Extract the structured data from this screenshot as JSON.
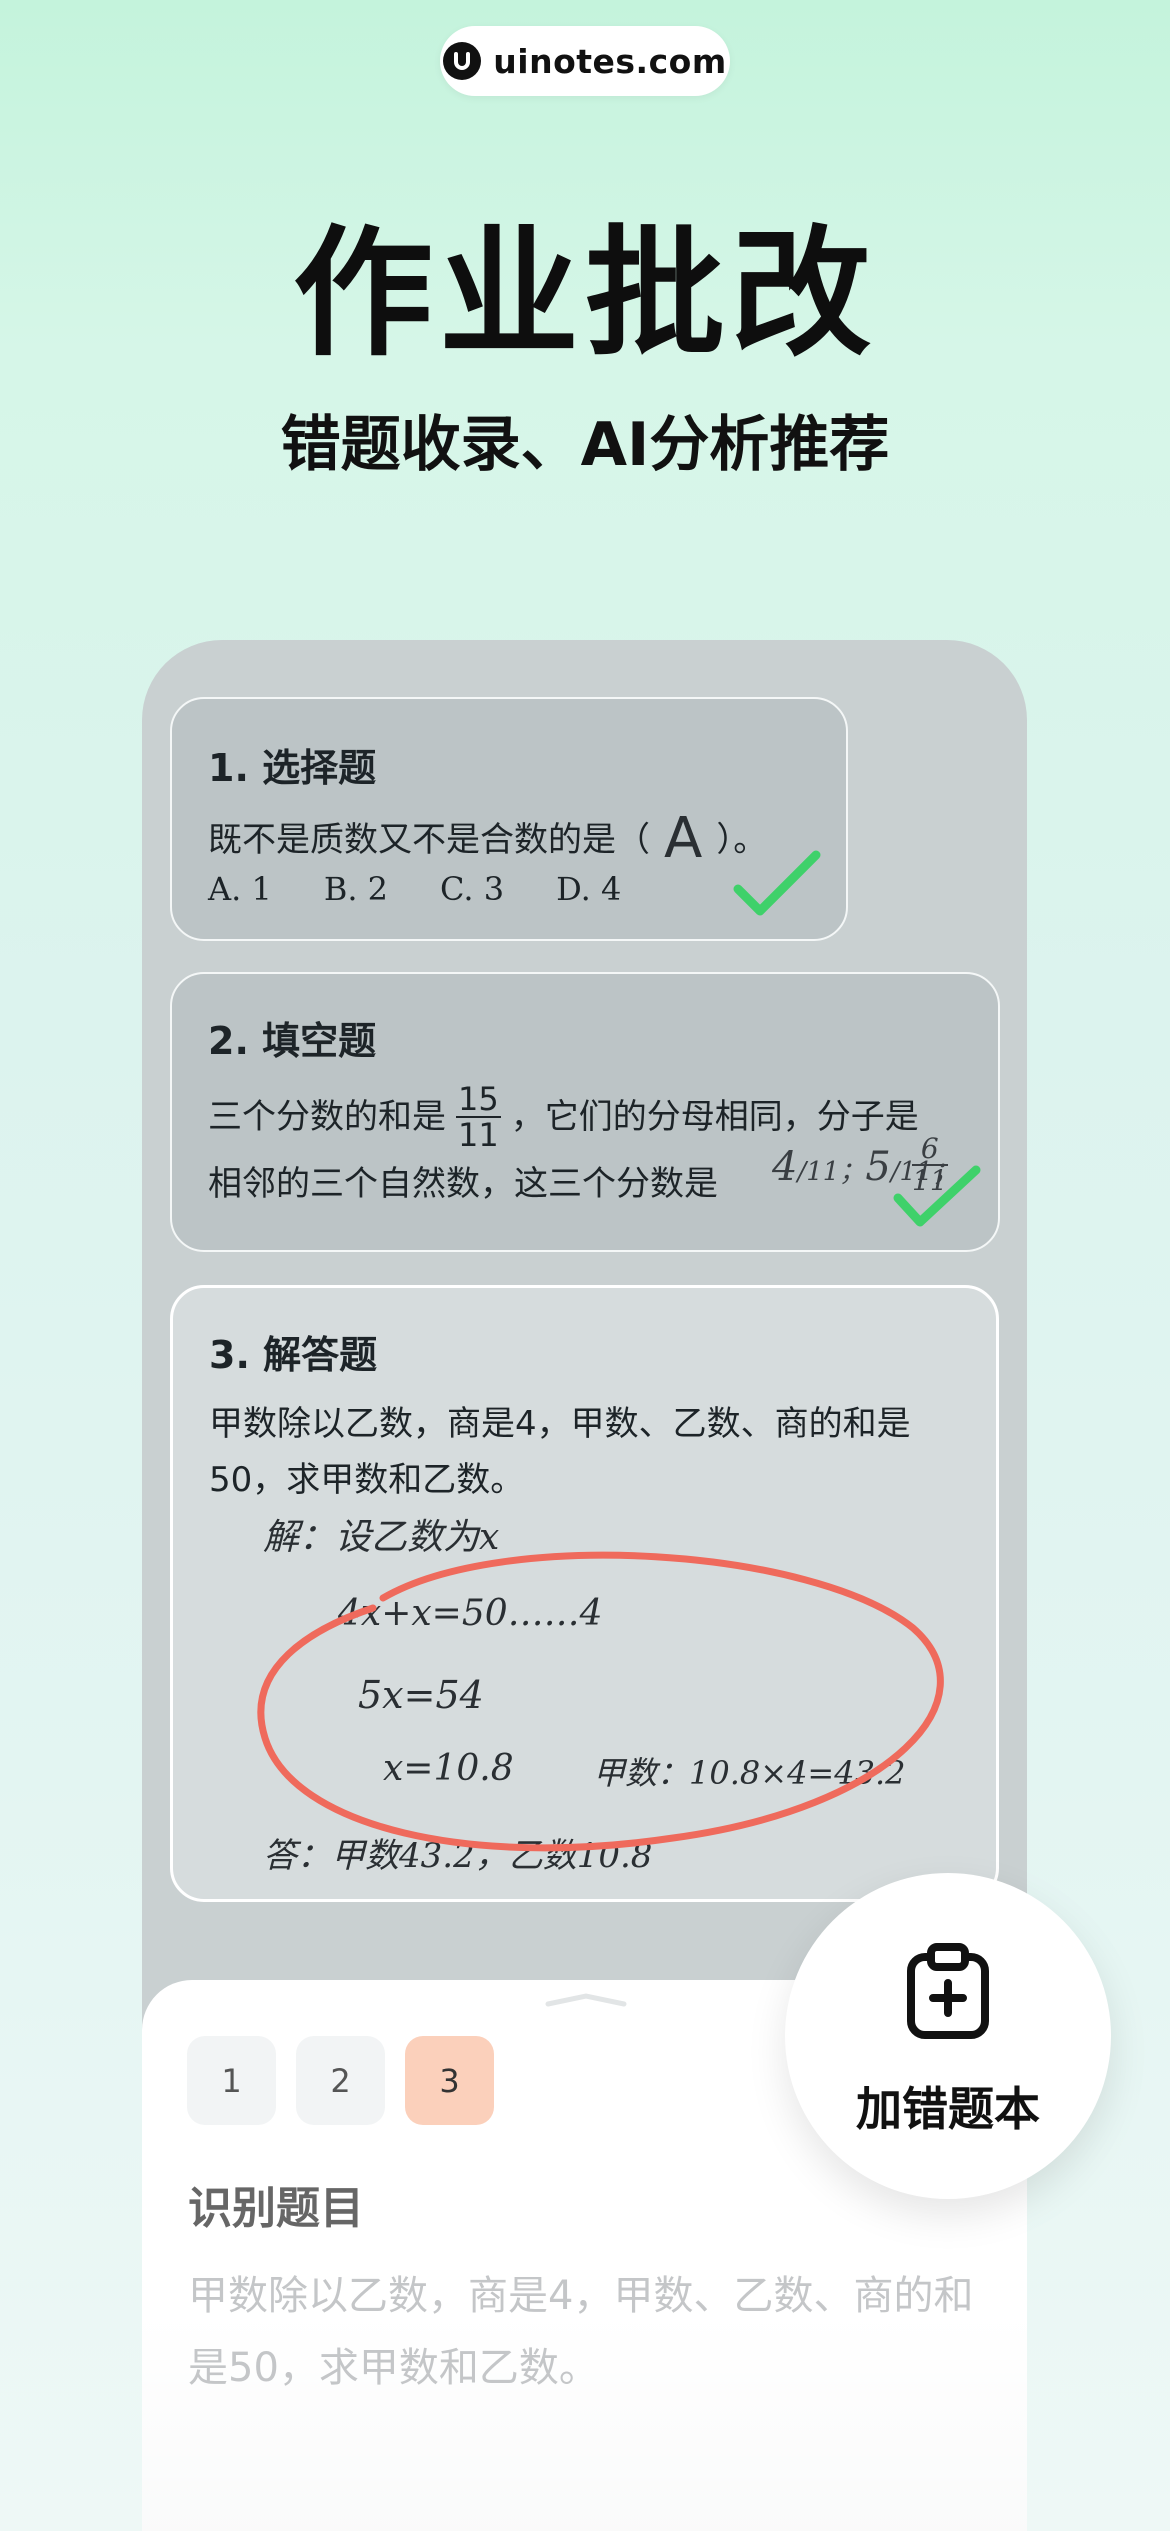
{
  "watermark": {
    "text": "uinotes.com"
  },
  "header": {
    "title": "作业批改",
    "subtitle": "错题收录、AI分析推荐"
  },
  "cards": [
    {
      "title": "1. 选择题",
      "question": "既不是质数又不是合数的是（",
      "answer": "A",
      "close": "）。",
      "options": [
        "A. 1",
        "B. 2",
        "C. 3",
        "D. 4"
      ]
    },
    {
      "title": "2. 填空题",
      "line1_prefix": "三个分数的和是",
      "frac_num": "15",
      "frac_den": "11",
      "line1_suffix": "，它们的分母相同，分子是",
      "line2": "相邻的三个自然数，这三个分数是",
      "hand_1": "4",
      "hand_2": "5",
      "hand_3_num": "6",
      "hand_3_den": "11"
    },
    {
      "title": "3. 解答题",
      "question_line1": "甲数除以乙数，商是4，甲数、乙数、商的和是",
      "question_line2": "50，求甲数和乙数。",
      "work": [
        "解：设乙数为x",
        "4x+x=50……4",
        "5x=54",
        "x=10.8",
        "甲数：10.8×4=43.2",
        "答：甲数43.2，乙数10.8"
      ]
    }
  ],
  "bottom_sheet": {
    "tabs": [
      "1",
      "2",
      "3"
    ],
    "active_tab": "3",
    "section_title": "识别题目",
    "recognized_text": "甲数除以乙数，商是4，甲数、乙数、商的和是50，求甲数和乙数。"
  },
  "fab": {
    "label": "加错题本",
    "icon": "clipboard-plus-icon"
  },
  "colors": {
    "check": "#3fd16a",
    "circle": "#ef6a5c",
    "active_tab": "#fbd0bb"
  }
}
